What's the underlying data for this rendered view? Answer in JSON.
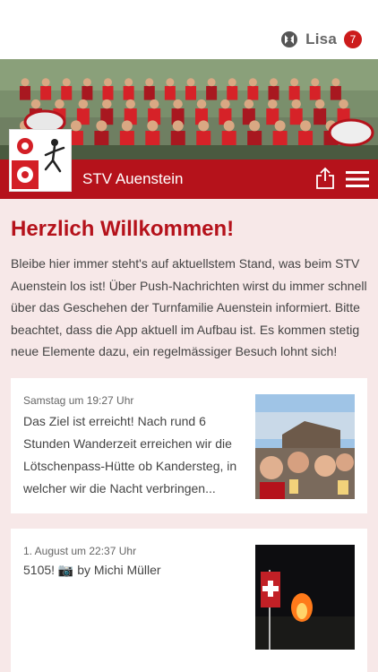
{
  "user": {
    "name": "Lisa",
    "notification_count": "7"
  },
  "app": {
    "title": "STV Auenstein"
  },
  "colors": {
    "primary": "#b5121b",
    "background": "#f7e8e8"
  },
  "welcome": {
    "title": "Herzlich Willkommen!",
    "text": "Bleibe hier immer steht's auf aktuellstem Stand, was beim STV Auenstein los ist! Über Push-Nachrichten wirst du immer schnell über das Geschehen der Turnfamilie Auenstein  informiert. Bitte beachtet, dass die App aktuell im Aufbau ist. Es kommen stetig neue Elemente dazu, ein regelmässiger Besuch lohnt sich!"
  },
  "posts": [
    {
      "date": "Samstag um 19:27 Uhr",
      "text": "Das Ziel ist erreicht! Nach rund 6 Stunden Wanderzeit erreichen wir die Lötschenpass-Hütte ob Kandersteg, in welcher wir die Nacht verbringen...",
      "image": "group-selfie-photo"
    },
    {
      "date": "1. August um 22:37 Uhr",
      "text": "5105! 📷 by Michi Müller",
      "image": "bonfire-flag-photo"
    }
  ],
  "icons": {
    "logo": "app-logo-icon",
    "share": "share-icon",
    "menu": "hamburger-menu-icon",
    "crest": "club-crest"
  }
}
